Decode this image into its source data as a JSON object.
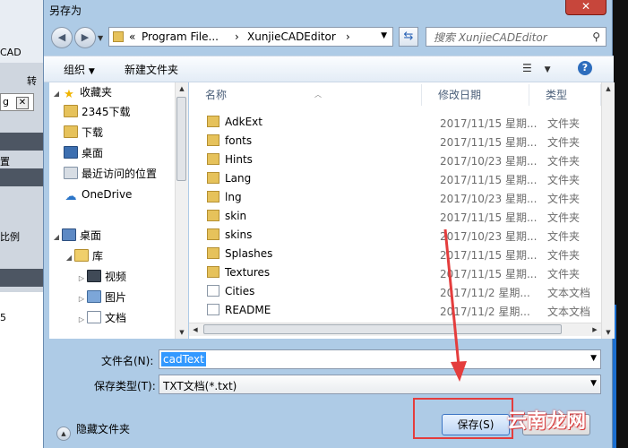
{
  "background_app": {
    "cad_label": "CAD",
    "zhuan_label": "转",
    "tab_label": "g",
    "tab_close": "✕",
    "left_text1": "置",
    "left_text2": "比例",
    "left_text3": "5"
  },
  "dialog": {
    "title": "另存为",
    "close_label": "✕"
  },
  "address": {
    "overflow": "«",
    "segments": [
      "Program File...",
      "XunjieCADEditor"
    ],
    "separator": "›"
  },
  "search": {
    "placeholder": "搜索 XunjieCADEditor"
  },
  "toolbar": {
    "organize": "组织",
    "new_folder": "新建文件夹",
    "help": "?"
  },
  "nav": {
    "items": [
      {
        "label": "收藏夹",
        "icon": "star-icon"
      },
      {
        "label": "2345下载",
        "icon": "folder-icon"
      },
      {
        "label": "下载",
        "icon": "folder-icon"
      },
      {
        "label": "桌面",
        "icon": "desktop-icon"
      },
      {
        "label": "最近访问的位置",
        "icon": "recent-icon"
      },
      {
        "label": "OneDrive",
        "icon": "cloud-icon"
      },
      {
        "label": "桌面",
        "icon": "computer-icon"
      },
      {
        "label": "库",
        "icon": "library-icon"
      },
      {
        "label": "视频",
        "icon": "video-icon"
      },
      {
        "label": "图片",
        "icon": "picture-icon"
      },
      {
        "label": "文档",
        "icon": "document-icon"
      }
    ]
  },
  "columns": {
    "name": "名称",
    "date": "修改日期",
    "type": "类型"
  },
  "files": [
    {
      "name": "AdkExt",
      "date": "2017/11/15 星期...",
      "type": "文件夹",
      "kind": "folder"
    },
    {
      "name": "fonts",
      "date": "2017/11/15 星期...",
      "type": "文件夹",
      "kind": "folder"
    },
    {
      "name": "Hints",
      "date": "2017/10/23 星期...",
      "type": "文件夹",
      "kind": "folder"
    },
    {
      "name": "Lang",
      "date": "2017/11/15 星期...",
      "type": "文件夹",
      "kind": "folder"
    },
    {
      "name": "lng",
      "date": "2017/10/23 星期...",
      "type": "文件夹",
      "kind": "folder"
    },
    {
      "name": "skin",
      "date": "2017/11/15 星期...",
      "type": "文件夹",
      "kind": "folder"
    },
    {
      "name": "skins",
      "date": "2017/10/23 星期...",
      "type": "文件夹",
      "kind": "folder"
    },
    {
      "name": "Splashes",
      "date": "2017/11/15 星期...",
      "type": "文件夹",
      "kind": "folder"
    },
    {
      "name": "Textures",
      "date": "2017/11/15 星期...",
      "type": "文件夹",
      "kind": "folder"
    },
    {
      "name": "Cities",
      "date": "2017/11/2 星期...",
      "type": "文本文档",
      "kind": "file"
    },
    {
      "name": "README",
      "date": "2017/11/2 星期...",
      "type": "文本文档",
      "kind": "file"
    }
  ],
  "filename": {
    "label": "文件名(N):",
    "value": "cadText"
  },
  "filetype": {
    "label": "保存类型(T):",
    "value": "TXT文档(*.txt)"
  },
  "footer": {
    "hide_folders": "隐藏文件夹",
    "save": "保存(S)"
  },
  "watermark": "云南龙网",
  "colors": {
    "annotation_red": "#e43d3d",
    "selection_blue": "#3399ff"
  }
}
